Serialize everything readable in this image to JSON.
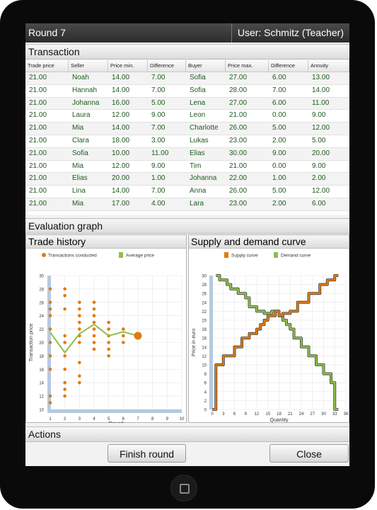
{
  "titlebar": {
    "round": "Round 7",
    "user": "User: Schmitz (Teacher)"
  },
  "sections": {
    "transaction": "Transaction",
    "evaluation": "Evaluation graph",
    "actions": "Actions"
  },
  "table": {
    "columns": [
      "Trade price",
      "Seller",
      "Price min.",
      "Difference",
      "Buyer",
      "Price max.",
      "Difference",
      "Annuity"
    ],
    "rows": [
      [
        "21.00",
        "Noah",
        "14.00",
        "7.00",
        "Sofia",
        "27.00",
        "6.00",
        "13.00"
      ],
      [
        "21.00",
        "Hannah",
        "14.00",
        "7.00",
        "Sofia",
        "28.00",
        "7.00",
        "14.00"
      ],
      [
        "21.00",
        "Johanna",
        "16.00",
        "5.00",
        "Lena",
        "27.00",
        "6.00",
        "11.00"
      ],
      [
        "21.00",
        "Laura",
        "12.00",
        "9.00",
        "Leon",
        "21.00",
        "0.00",
        "9.00"
      ],
      [
        "21.00",
        "Mia",
        "14.00",
        "7.00",
        "Charlotte",
        "26.00",
        "5.00",
        "12.00"
      ],
      [
        "21.00",
        "Clara",
        "18.00",
        "3.00",
        "Lukas",
        "23.00",
        "2.00",
        "5.00"
      ],
      [
        "21.00",
        "Sofia",
        "10.00",
        "11.00",
        "Elias",
        "30.00",
        "9.00",
        "20.00"
      ],
      [
        "21.00",
        "Mia",
        "12.00",
        "9.00",
        "Tim",
        "21.00",
        "0.00",
        "9.00"
      ],
      [
        "21.00",
        "Elias",
        "20.00",
        "1.00",
        "Johanna",
        "22.00",
        "1.00",
        "2.00"
      ],
      [
        "21.00",
        "Lina",
        "14.00",
        "7.00",
        "Anna",
        "26.00",
        "5.00",
        "12.00"
      ],
      [
        "21.00",
        "Mia",
        "17.00",
        "4.00",
        "Lara",
        "23.00",
        "2.00",
        "6.00"
      ]
    ]
  },
  "panels": {
    "trade_history": "Trade history",
    "supply_demand": "Supply and demand curve"
  },
  "buttons": {
    "finish": "Finish round",
    "close": "Close"
  },
  "colors": {
    "accent_orange": "#e07b10",
    "accent_green": "#8fbe4a",
    "text_green": "#1e5a1e"
  },
  "chart_data": [
    {
      "type": "scatter",
      "title": "",
      "xlabel": "Round",
      "ylabel": "Transaction price",
      "xlim": [
        1,
        10
      ],
      "ylim": [
        10,
        30
      ],
      "xticks": [
        1,
        2,
        3,
        4,
        5,
        6,
        7,
        8,
        9,
        10
      ],
      "yticks": [
        10,
        12,
        14,
        16,
        18,
        20,
        22,
        24,
        26,
        28,
        30
      ],
      "legend": [
        "Transactions conducted",
        "Average price"
      ],
      "series": [
        {
          "name": "Transactions conducted",
          "points": [
            [
              1,
              11
            ],
            [
              1,
              12
            ],
            [
              1,
              16
            ],
            [
              1,
              18
            ],
            [
              1,
              20
            ],
            [
              1,
              22
            ],
            [
              1,
              24
            ],
            [
              1,
              25
            ],
            [
              1,
              26
            ],
            [
              1,
              28
            ],
            [
              2,
              12
            ],
            [
              2,
              13
            ],
            [
              2,
              14
            ],
            [
              2,
              16
            ],
            [
              2,
              18
            ],
            [
              2,
              20
            ],
            [
              2,
              21
            ],
            [
              2,
              25
            ],
            [
              2,
              27
            ],
            [
              2,
              28
            ],
            [
              3,
              14
            ],
            [
              3,
              15
            ],
            [
              3,
              17
            ],
            [
              3,
              20
            ],
            [
              3,
              21
            ],
            [
              3,
              22
            ],
            [
              3,
              23
            ],
            [
              3,
              24
            ],
            [
              3,
              25
            ],
            [
              3,
              26
            ],
            [
              4,
              19
            ],
            [
              4,
              20
            ],
            [
              4,
              21
            ],
            [
              4,
              22
            ],
            [
              4,
              23
            ],
            [
              4,
              24
            ],
            [
              4,
              25
            ],
            [
              4,
              26
            ],
            [
              5,
              18
            ],
            [
              5,
              19
            ],
            [
              5,
              20
            ],
            [
              5,
              21
            ],
            [
              5,
              22
            ],
            [
              5,
              23
            ],
            [
              6,
              20
            ],
            [
              6,
              21
            ],
            [
              6,
              22
            ],
            [
              7,
              21
            ]
          ]
        },
        {
          "name": "Average price",
          "x": [
            1,
            2,
            3,
            4,
            5,
            6,
            7
          ],
          "values": [
            21.5,
            18.5,
            21.3,
            22.7,
            21.0,
            21.6,
            21.0
          ]
        }
      ]
    },
    {
      "type": "line",
      "title": "",
      "xlabel": "Quantity",
      "ylabel": "Price in euro",
      "xlim": [
        0,
        36
      ],
      "ylim": [
        0,
        30
      ],
      "xticks": [
        0,
        3,
        6,
        9,
        12,
        15,
        18,
        21,
        24,
        27,
        30,
        33,
        36
      ],
      "yticks": [
        0,
        2,
        4,
        6,
        8,
        10,
        12,
        14,
        16,
        18,
        20,
        22,
        24,
        26,
        28,
        30
      ],
      "legend": [
        "Supply curve",
        "Demand curve"
      ],
      "series": [
        {
          "name": "Supply curve",
          "points": [
            [
              0,
              0
            ],
            [
              1,
              0
            ],
            [
              1,
              10
            ],
            [
              3,
              10
            ],
            [
              3,
              12
            ],
            [
              6,
              12
            ],
            [
              6,
              14
            ],
            [
              8,
              14
            ],
            [
              8,
              16
            ],
            [
              10,
              16
            ],
            [
              10,
              17
            ],
            [
              12,
              17
            ],
            [
              12,
              18
            ],
            [
              13,
              18
            ],
            [
              13,
              19
            ],
            [
              14,
              19
            ],
            [
              14,
              20
            ],
            [
              15,
              20
            ],
            [
              15,
              21
            ],
            [
              17,
              21
            ],
            [
              17,
              22
            ],
            [
              18,
              22
            ],
            [
              18,
              21
            ],
            [
              19,
              21
            ],
            [
              19,
              21.5
            ],
            [
              21,
              21.5
            ],
            [
              21,
              22
            ],
            [
              23,
              22
            ],
            [
              23,
              24
            ],
            [
              26,
              24
            ],
            [
              26,
              26
            ],
            [
              29,
              26
            ],
            [
              29,
              28
            ],
            [
              31,
              28
            ],
            [
              31,
              29
            ],
            [
              33,
              29
            ],
            [
              33,
              30
            ],
            [
              34,
              30
            ]
          ]
        },
        {
          "name": "Demand curve",
          "points": [
            [
              1,
              30
            ],
            [
              2,
              30
            ],
            [
              2,
              29
            ],
            [
              4,
              29
            ],
            [
              4,
              28
            ],
            [
              5,
              28
            ],
            [
              5,
              27
            ],
            [
              7,
              27
            ],
            [
              7,
              26
            ],
            [
              9,
              26
            ],
            [
              9,
              25
            ],
            [
              10,
              25
            ],
            [
              10,
              23
            ],
            [
              12,
              23
            ],
            [
              12,
              22
            ],
            [
              14,
              22
            ],
            [
              14,
              21.5
            ],
            [
              16,
              21.5
            ],
            [
              16,
              22
            ],
            [
              18,
              22
            ],
            [
              18,
              21
            ],
            [
              19,
              21
            ],
            [
              19,
              20
            ],
            [
              20,
              20
            ],
            [
              20,
              19
            ],
            [
              21,
              19
            ],
            [
              21,
              18
            ],
            [
              22,
              18
            ],
            [
              22,
              16
            ],
            [
              24,
              16
            ],
            [
              24,
              14
            ],
            [
              26,
              14
            ],
            [
              26,
              12
            ],
            [
              28,
              12
            ],
            [
              28,
              10
            ],
            [
              30,
              10
            ],
            [
              30,
              8
            ],
            [
              32,
              8
            ],
            [
              32,
              6
            ],
            [
              33,
              6
            ],
            [
              33,
              0
            ],
            [
              34,
              0
            ]
          ]
        }
      ]
    }
  ]
}
